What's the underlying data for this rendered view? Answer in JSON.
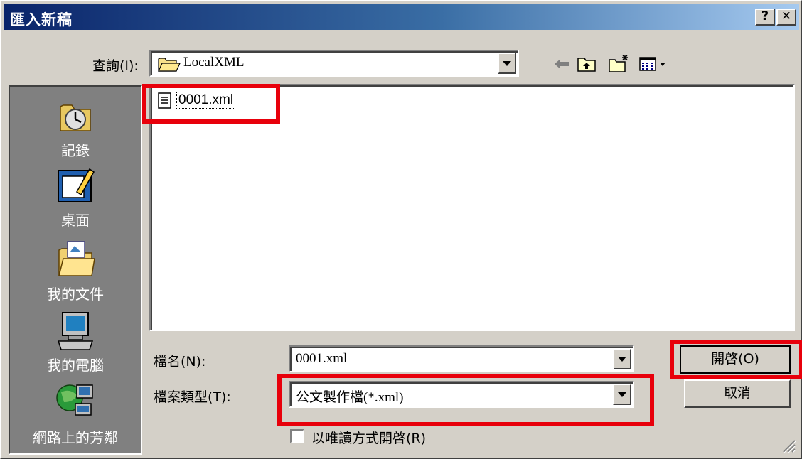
{
  "dialog": {
    "title": "匯入新稿",
    "help_label": "?",
    "close_label": "✕"
  },
  "lookin": {
    "label": "查詢(I):",
    "value": "LocalXML"
  },
  "toolbar": {
    "back_icon": "back-arrow-icon",
    "up_icon": "up-folder-icon",
    "new_folder_icon": "new-folder-icon",
    "view_icon": "view-menu-icon"
  },
  "places": [
    {
      "label": "記錄",
      "icon": "history-icon"
    },
    {
      "label": "桌面",
      "icon": "desktop-icon"
    },
    {
      "label": "我的文件",
      "icon": "my-documents-icon"
    },
    {
      "label": "我的電腦",
      "icon": "my-computer-icon"
    },
    {
      "label": "網路上的芳鄰",
      "icon": "network-places-icon"
    }
  ],
  "files": [
    {
      "name": "0001.xml",
      "icon": "xml-file-icon"
    }
  ],
  "filename": {
    "label": "檔名(N):",
    "value": "0001.xml"
  },
  "filetype": {
    "label": "檔案類型(T):",
    "value": "公文製作檔(*.xml)"
  },
  "readonly": {
    "label": "以唯讀方式開啓(R)"
  },
  "buttons": {
    "open": "開啓(O)",
    "cancel": "取消"
  },
  "highlight_color": "#e8000b"
}
